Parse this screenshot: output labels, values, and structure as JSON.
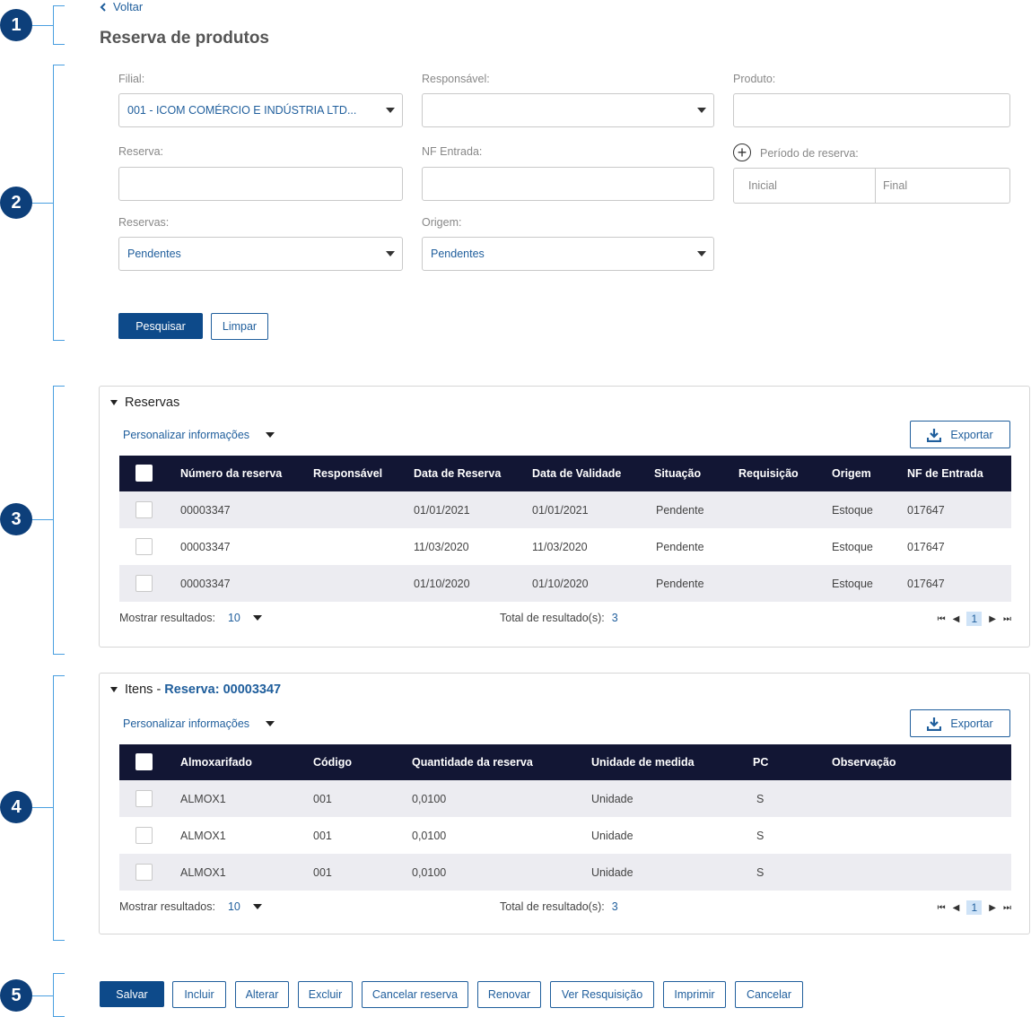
{
  "markers": [
    "1",
    "2",
    "3",
    "4",
    "5"
  ],
  "header": {
    "back_label": "Voltar",
    "title": "Reserva de produtos"
  },
  "filters": {
    "filial": {
      "label": "Filial:",
      "value": "001 - ICOM COMÉRCIO E INDÚSTRIA LTD..."
    },
    "responsavel": {
      "label": "Responsável:",
      "value": ""
    },
    "produto": {
      "label": "Produto:",
      "value": ""
    },
    "reserva": {
      "label": "Reserva:",
      "value": ""
    },
    "nf_entrada": {
      "label": "NF Entrada:",
      "value": ""
    },
    "periodo": {
      "label": "Período de reserva:",
      "inicial": "Inicial",
      "final": "Final"
    },
    "reservas": {
      "label": "Reservas:",
      "value": "Pendentes"
    },
    "origem": {
      "label": "Origem:",
      "value": "Pendentes"
    },
    "search_label": "Pesquisar",
    "clear_label": "Limpar"
  },
  "reservas_panel": {
    "title": "Reservas",
    "personalize_label": "Personalizar informações",
    "export_label": "Exportar",
    "columns": [
      "Número da reserva",
      "Responsável",
      "Data de Reserva",
      "Data de Validade",
      "Situação",
      "Requisição",
      "Origem",
      "NF de Entrada"
    ],
    "rows": [
      [
        "00003347",
        "",
        "01/01/2021",
        "01/01/2021",
        "Pendente",
        "",
        "Estoque",
        "017647"
      ],
      [
        "00003347",
        "",
        "11/03/2020",
        "11/03/2020",
        "Pendente",
        "",
        "Estoque",
        "017647"
      ],
      [
        "00003347",
        "",
        "01/10/2020",
        "01/10/2020",
        "Pendente",
        "",
        "Estoque",
        "017647"
      ]
    ],
    "show_label": "Mostrar resultados:",
    "page_size": "10",
    "total_label": "Total de resultado(s):",
    "total": "3",
    "current_page": "1"
  },
  "itens_panel": {
    "title_prefix": "Itens -",
    "title_reserva": "Reserva: 00003347",
    "personalize_label": "Personalizar informações",
    "export_label": "Exportar",
    "columns": [
      "Almoxarifado",
      "Código",
      "Quantidade da reserva",
      "Unidade de medida",
      "PC",
      "Observação"
    ],
    "rows": [
      [
        "ALMOX1",
        "001",
        "0,0100",
        "Unidade",
        "S",
        ""
      ],
      [
        "ALMOX1",
        "001",
        "0,0100",
        "Unidade",
        "S",
        ""
      ],
      [
        "ALMOX1",
        "001",
        "0,0100",
        "Unidade",
        "S",
        ""
      ]
    ],
    "show_label": "Mostrar resultados:",
    "page_size": "10",
    "total_label": "Total de resultado(s):",
    "total": "3",
    "current_page": "1"
  },
  "actions": {
    "salvar": "Salvar",
    "incluir": "Incluir",
    "alterar": "Alterar",
    "excluir": "Excluir",
    "cancelar_reserva": "Cancelar reserva",
    "renovar": "Renovar",
    "ver_requisicao": "Ver Resquisição",
    "imprimir": "Imprimir",
    "cancelar": "Cancelar"
  },
  "colors": {
    "primary": "#0d4a8a",
    "link": "#1f5e9c",
    "table_header": "#121634",
    "marker": "#0d3f7a",
    "bracket": "#4a9fe0"
  }
}
